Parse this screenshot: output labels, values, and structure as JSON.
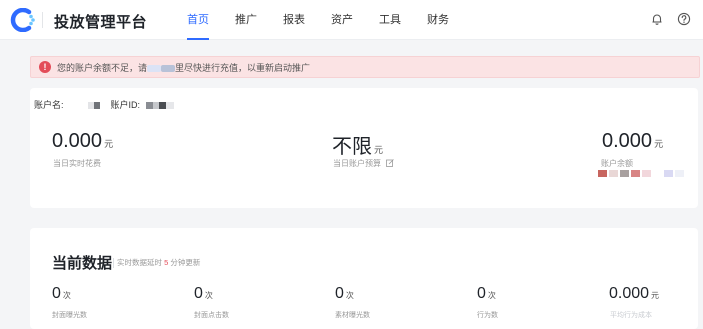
{
  "app": {
    "brand": "投放管理平台",
    "accent_color": "#2f6bff",
    "logo_icon": "c-logo-icon"
  },
  "nav": {
    "items": [
      {
        "label": "首页",
        "active": true
      },
      {
        "label": "推广",
        "active": false
      },
      {
        "label": "报表",
        "active": false
      },
      {
        "label": "资产",
        "active": false
      },
      {
        "label": "工具",
        "active": false
      },
      {
        "label": "财务",
        "active": false
      }
    ]
  },
  "header_icons": [
    "bell-icon",
    "help-icon"
  ],
  "alert": {
    "icon": "alert-icon",
    "text_before": "您的账户余额不足，请",
    "text_mid": "里",
    "text_after": "尽快进行充值，以重新启动推广",
    "color": "#fbe3e4"
  },
  "account": {
    "name_label": "账户名:",
    "id_label": "账户ID:"
  },
  "overview": {
    "spend": {
      "value": "0.000",
      "unit": "元",
      "label": "当日实时花费"
    },
    "budget": {
      "value": "不限",
      "unit": "元",
      "label": "当日账户预算"
    },
    "balance": {
      "value": "0.000",
      "unit": "元",
      "label": "账户余额"
    }
  },
  "current_data": {
    "title": "当前数据",
    "note_prefix": "实时数据延时",
    "note_num": "5",
    "note_suffix": "分钟更新",
    "stats": [
      {
        "value": "0",
        "unit": "次",
        "label": "封面曝光数"
      },
      {
        "value": "0",
        "unit": "次",
        "label": "封面点击数"
      },
      {
        "value": "0",
        "unit": "次",
        "label": "素材曝光数"
      },
      {
        "value": "0",
        "unit": "次",
        "label": "行为数"
      },
      {
        "value": "0.000",
        "unit": "元",
        "label": "平均行为成本"
      }
    ]
  }
}
